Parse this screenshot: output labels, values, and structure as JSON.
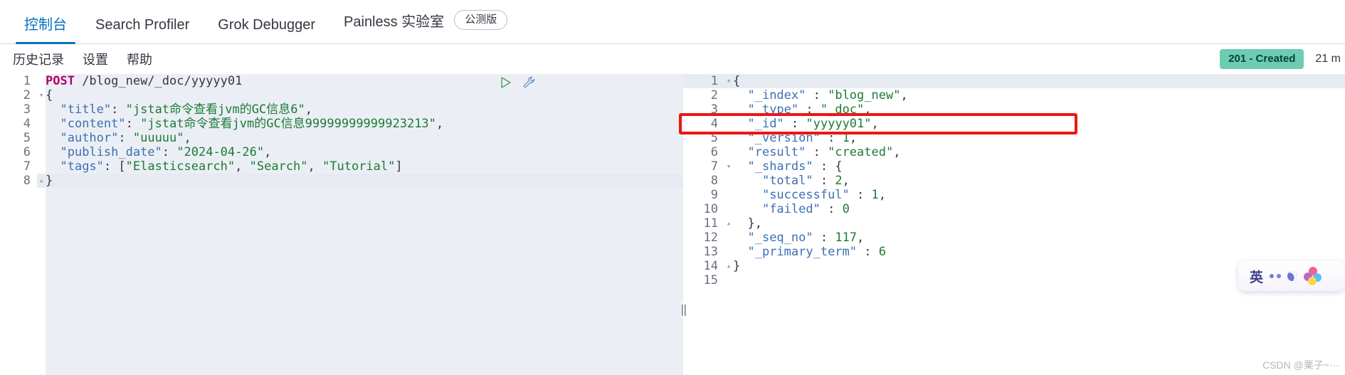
{
  "tabs": [
    {
      "label": "控制台",
      "active": true,
      "badge": null
    },
    {
      "label": "Search Profiler",
      "active": false,
      "badge": null
    },
    {
      "label": "Grok Debugger",
      "active": false,
      "badge": null
    },
    {
      "label": "Painless 实验室",
      "active": false,
      "badge": "公测版"
    }
  ],
  "subnav": {
    "items": [
      {
        "label": "历史记录"
      },
      {
        "label": "设置"
      },
      {
        "label": "帮助"
      }
    ],
    "status_badge": "201 - Created",
    "status_time": "21 m"
  },
  "icons": {
    "run": "play-icon",
    "wrench": "wrench-icon",
    "drag": "resize-handle-icon"
  },
  "request_editor": {
    "lines": [
      {
        "n": "1",
        "fold": "",
        "tokens": [
          {
            "t": "POST",
            "c": "k-method"
          },
          {
            "t": " /blog_new/_doc/yyyyy01",
            "c": "k-url"
          }
        ]
      },
      {
        "n": "2",
        "fold": "▾",
        "tokens": [
          {
            "t": "{",
            "c": "k-brace"
          }
        ]
      },
      {
        "n": "3",
        "fold": "",
        "tokens": [
          {
            "t": "  ",
            "c": "k-punct"
          },
          {
            "t": "\"title\"",
            "c": "k-key"
          },
          {
            "t": ": ",
            "c": "k-punct"
          },
          {
            "t": "\"jstat命令查看jvm的GC信息6\"",
            "c": "k-str"
          },
          {
            "t": ",",
            "c": "k-punct"
          }
        ]
      },
      {
        "n": "4",
        "fold": "",
        "tokens": [
          {
            "t": "  ",
            "c": "k-punct"
          },
          {
            "t": "\"content\"",
            "c": "k-key"
          },
          {
            "t": ": ",
            "c": "k-punct"
          },
          {
            "t": "\"jstat命令查看jvm的GC信息99999999999923213\"",
            "c": "k-str"
          },
          {
            "t": ",",
            "c": "k-punct"
          }
        ]
      },
      {
        "n": "5",
        "fold": "",
        "tokens": [
          {
            "t": "  ",
            "c": "k-punct"
          },
          {
            "t": "\"author\"",
            "c": "k-key"
          },
          {
            "t": ": ",
            "c": "k-punct"
          },
          {
            "t": "\"uuuuu\"",
            "c": "k-str"
          },
          {
            "t": ",",
            "c": "k-punct"
          }
        ]
      },
      {
        "n": "6",
        "fold": "",
        "tokens": [
          {
            "t": "  ",
            "c": "k-punct"
          },
          {
            "t": "\"publish_date\"",
            "c": "k-key"
          },
          {
            "t": ": ",
            "c": "k-punct"
          },
          {
            "t": "\"2024-04-26\"",
            "c": "k-str"
          },
          {
            "t": ",",
            "c": "k-punct"
          }
        ]
      },
      {
        "n": "7",
        "fold": "",
        "tokens": [
          {
            "t": "  ",
            "c": "k-punct"
          },
          {
            "t": "\"tags\"",
            "c": "k-key"
          },
          {
            "t": ": [",
            "c": "k-punct"
          },
          {
            "t": "\"Elasticsearch\"",
            "c": "k-str"
          },
          {
            "t": ", ",
            "c": "k-punct"
          },
          {
            "t": "\"Search\"",
            "c": "k-str"
          },
          {
            "t": ", ",
            "c": "k-punct"
          },
          {
            "t": "\"Tutorial\"",
            "c": "k-str"
          },
          {
            "t": "]",
            "c": "k-punct"
          }
        ]
      },
      {
        "n": "8",
        "fold": "▴",
        "selected": true,
        "tokens": [
          {
            "t": "}",
            "c": "k-brace"
          }
        ]
      }
    ]
  },
  "response_editor": {
    "lines": [
      {
        "n": "1",
        "fold": "▾",
        "first": true,
        "tokens": [
          {
            "t": "{",
            "c": "k-brace"
          }
        ]
      },
      {
        "n": "2",
        "fold": "",
        "tokens": [
          {
            "t": "  ",
            "c": "k-punct"
          },
          {
            "t": "\"_index\"",
            "c": "k-key"
          },
          {
            "t": " : ",
            "c": "k-punct"
          },
          {
            "t": "\"blog_new\"",
            "c": "k-str"
          },
          {
            "t": ",",
            "c": "k-punct"
          }
        ]
      },
      {
        "n": "3",
        "fold": "",
        "tokens": [
          {
            "t": "  ",
            "c": "k-punct"
          },
          {
            "t": "\"_type\"",
            "c": "k-key"
          },
          {
            "t": " : ",
            "c": "k-punct"
          },
          {
            "t": "\"_doc\"",
            "c": "k-str"
          },
          {
            "t": ",",
            "c": "k-punct"
          }
        ]
      },
      {
        "n": "4",
        "fold": "",
        "tokens": [
          {
            "t": "  ",
            "c": "k-punct"
          },
          {
            "t": "\"_id\"",
            "c": "k-key"
          },
          {
            "t": " : ",
            "c": "k-punct"
          },
          {
            "t": "\"yyyyy01\"",
            "c": "k-str"
          },
          {
            "t": ",",
            "c": "k-punct"
          }
        ]
      },
      {
        "n": "5",
        "fold": "",
        "tokens": [
          {
            "t": "  ",
            "c": "k-punct"
          },
          {
            "t": "\"_version\"",
            "c": "k-key"
          },
          {
            "t": " : ",
            "c": "k-punct"
          },
          {
            "t": "1",
            "c": "k-str"
          },
          {
            "t": ",",
            "c": "k-punct"
          }
        ]
      },
      {
        "n": "6",
        "fold": "",
        "tokens": [
          {
            "t": "  ",
            "c": "k-punct"
          },
          {
            "t": "\"result\"",
            "c": "k-key"
          },
          {
            "t": " : ",
            "c": "k-punct"
          },
          {
            "t": "\"created\"",
            "c": "k-str"
          },
          {
            "t": ",",
            "c": "k-punct"
          }
        ]
      },
      {
        "n": "7",
        "fold": "▾",
        "tokens": [
          {
            "t": "  ",
            "c": "k-punct"
          },
          {
            "t": "\"_shards\"",
            "c": "k-key"
          },
          {
            "t": " : {",
            "c": "k-punct"
          }
        ]
      },
      {
        "n": "8",
        "fold": "",
        "tokens": [
          {
            "t": "    ",
            "c": "k-punct"
          },
          {
            "t": "\"total\"",
            "c": "k-key"
          },
          {
            "t": " : ",
            "c": "k-punct"
          },
          {
            "t": "2",
            "c": "k-str"
          },
          {
            "t": ",",
            "c": "k-punct"
          }
        ]
      },
      {
        "n": "9",
        "fold": "",
        "tokens": [
          {
            "t": "    ",
            "c": "k-punct"
          },
          {
            "t": "\"successful\"",
            "c": "k-key"
          },
          {
            "t": " : ",
            "c": "k-punct"
          },
          {
            "t": "1",
            "c": "k-str"
          },
          {
            "t": ",",
            "c": "k-punct"
          }
        ]
      },
      {
        "n": "10",
        "fold": "",
        "tokens": [
          {
            "t": "    ",
            "c": "k-punct"
          },
          {
            "t": "\"failed\"",
            "c": "k-key"
          },
          {
            "t": " : ",
            "c": "k-punct"
          },
          {
            "t": "0",
            "c": "k-str"
          }
        ]
      },
      {
        "n": "11",
        "fold": "▴",
        "tokens": [
          {
            "t": "  },",
            "c": "k-punct"
          }
        ]
      },
      {
        "n": "12",
        "fold": "",
        "tokens": [
          {
            "t": "  ",
            "c": "k-punct"
          },
          {
            "t": "\"_seq_no\"",
            "c": "k-key"
          },
          {
            "t": " : ",
            "c": "k-punct"
          },
          {
            "t": "117",
            "c": "k-str"
          },
          {
            "t": ",",
            "c": "k-punct"
          }
        ]
      },
      {
        "n": "13",
        "fold": "",
        "tokens": [
          {
            "t": "  ",
            "c": "k-punct"
          },
          {
            "t": "\"_primary_term\"",
            "c": "k-key"
          },
          {
            "t": " : ",
            "c": "k-punct"
          },
          {
            "t": "6",
            "c": "k-str"
          }
        ]
      },
      {
        "n": "14",
        "fold": "▴",
        "tokens": [
          {
            "t": "}",
            "c": "k-brace"
          }
        ]
      },
      {
        "n": "15",
        "fold": "",
        "tokens": []
      }
    ]
  },
  "annotation": {
    "color": "#f01414",
    "target": "_id-line"
  },
  "ime_widget": {
    "label": "英"
  },
  "watermark": "CSDN @栗子~···"
}
